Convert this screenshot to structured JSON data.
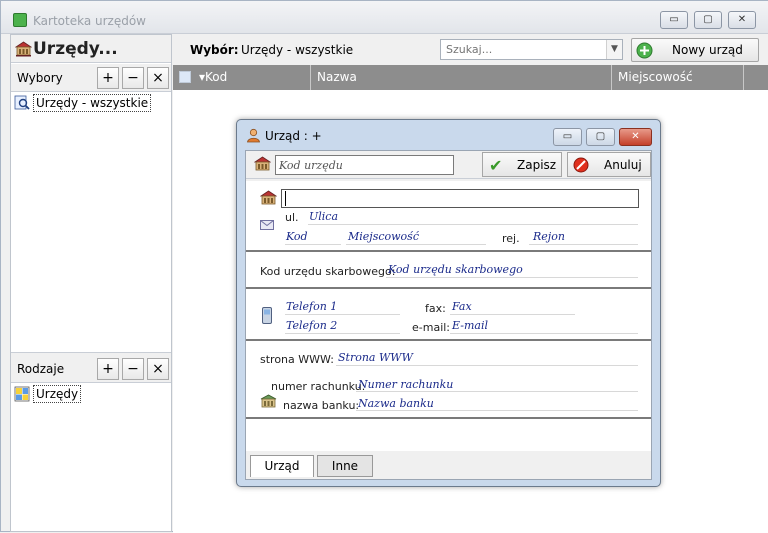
{
  "window": {
    "title": "Kartoteka urzędów",
    "caption_minimize": "▭",
    "caption_maximize": "▢",
    "caption_close": "✕"
  },
  "left": {
    "header_title": "Urzędy...",
    "wybory": {
      "label": "Wybory",
      "add": "+",
      "remove": "−",
      "close": "×",
      "items": [
        {
          "label": "Urzędy - wszystkie"
        }
      ]
    },
    "rodzaje": {
      "label": "Rodzaje",
      "add": "+",
      "remove": "−",
      "close": "×",
      "items": [
        {
          "label": "Urzędy"
        }
      ]
    }
  },
  "main": {
    "wybor_label": "Wybór:",
    "wybor_value": "Urzędy - wszystkie",
    "search_placeholder": "Szukaj...",
    "new_button": "Nowy urząd",
    "columns": [
      "▾Kod",
      "Nazwa",
      "Miejscowość"
    ]
  },
  "dialog": {
    "title": "Urząd : +",
    "kod_placeholder": "Kod urzędu",
    "save": "Zapisz",
    "cancel": "Anuluj",
    "name_value": "",
    "ul_label": "ul.",
    "ulica": "Ulica",
    "kod": "Kod",
    "miejscowosc": "Miejscowość",
    "rej_label": "rej.",
    "rejon": "Rejon",
    "skarbowy_label": "Kod urzędu skarbowego:",
    "skarbowy_value": "Kod urzędu skarbowego",
    "telefon1": "Telefon 1",
    "telefon2": "Telefon 2",
    "fax_label": "fax:",
    "fax_value": "Fax",
    "email_label": "e-mail:",
    "email_value": "E-mail",
    "www_label": "strona WWW:",
    "www_value": "Strona WWW",
    "rachunek_label": "numer rachunku:",
    "rachunek_value": "Numer rachunku",
    "bank_label": "nazwa banku:",
    "bank_value": "Nazwa banku",
    "tabs": [
      "Urząd",
      "Inne"
    ]
  }
}
